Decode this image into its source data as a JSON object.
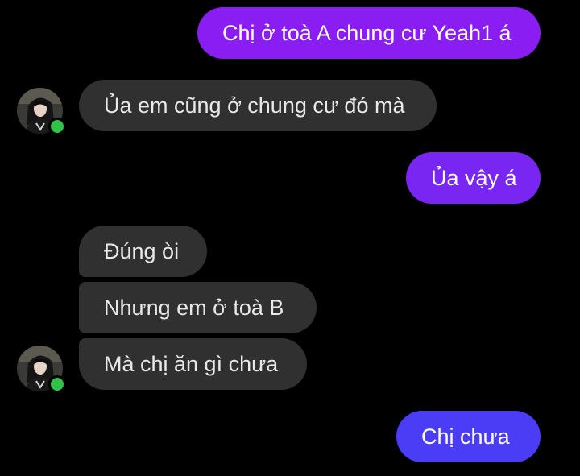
{
  "colors": {
    "background": "#000000",
    "received_bubble": "#303030",
    "received_text": "#e8e8e8",
    "sent_gradient_top": "#8c1cf2",
    "sent_gradient_bottom": "#4a3cf5",
    "sent_text": "#ffffff",
    "presence_dot": "#31c24a"
  },
  "messages": [
    {
      "direction": "sent",
      "text": "Chị ở toà A chung cư Yeah1 á"
    },
    {
      "direction": "received",
      "text": "Ủa em cũng ở chung cư đó mà"
    },
    {
      "direction": "sent",
      "text": "Ủa vậy á"
    },
    {
      "direction": "received",
      "text": "Đúng òi"
    },
    {
      "direction": "received",
      "text": "Nhưng em ở toà B"
    },
    {
      "direction": "received",
      "text": "Mà chị ăn gì chưa"
    },
    {
      "direction": "sent",
      "text": "Chị chưa"
    }
  ],
  "contact": {
    "avatar_icon": "contact-avatar",
    "status": "online"
  }
}
